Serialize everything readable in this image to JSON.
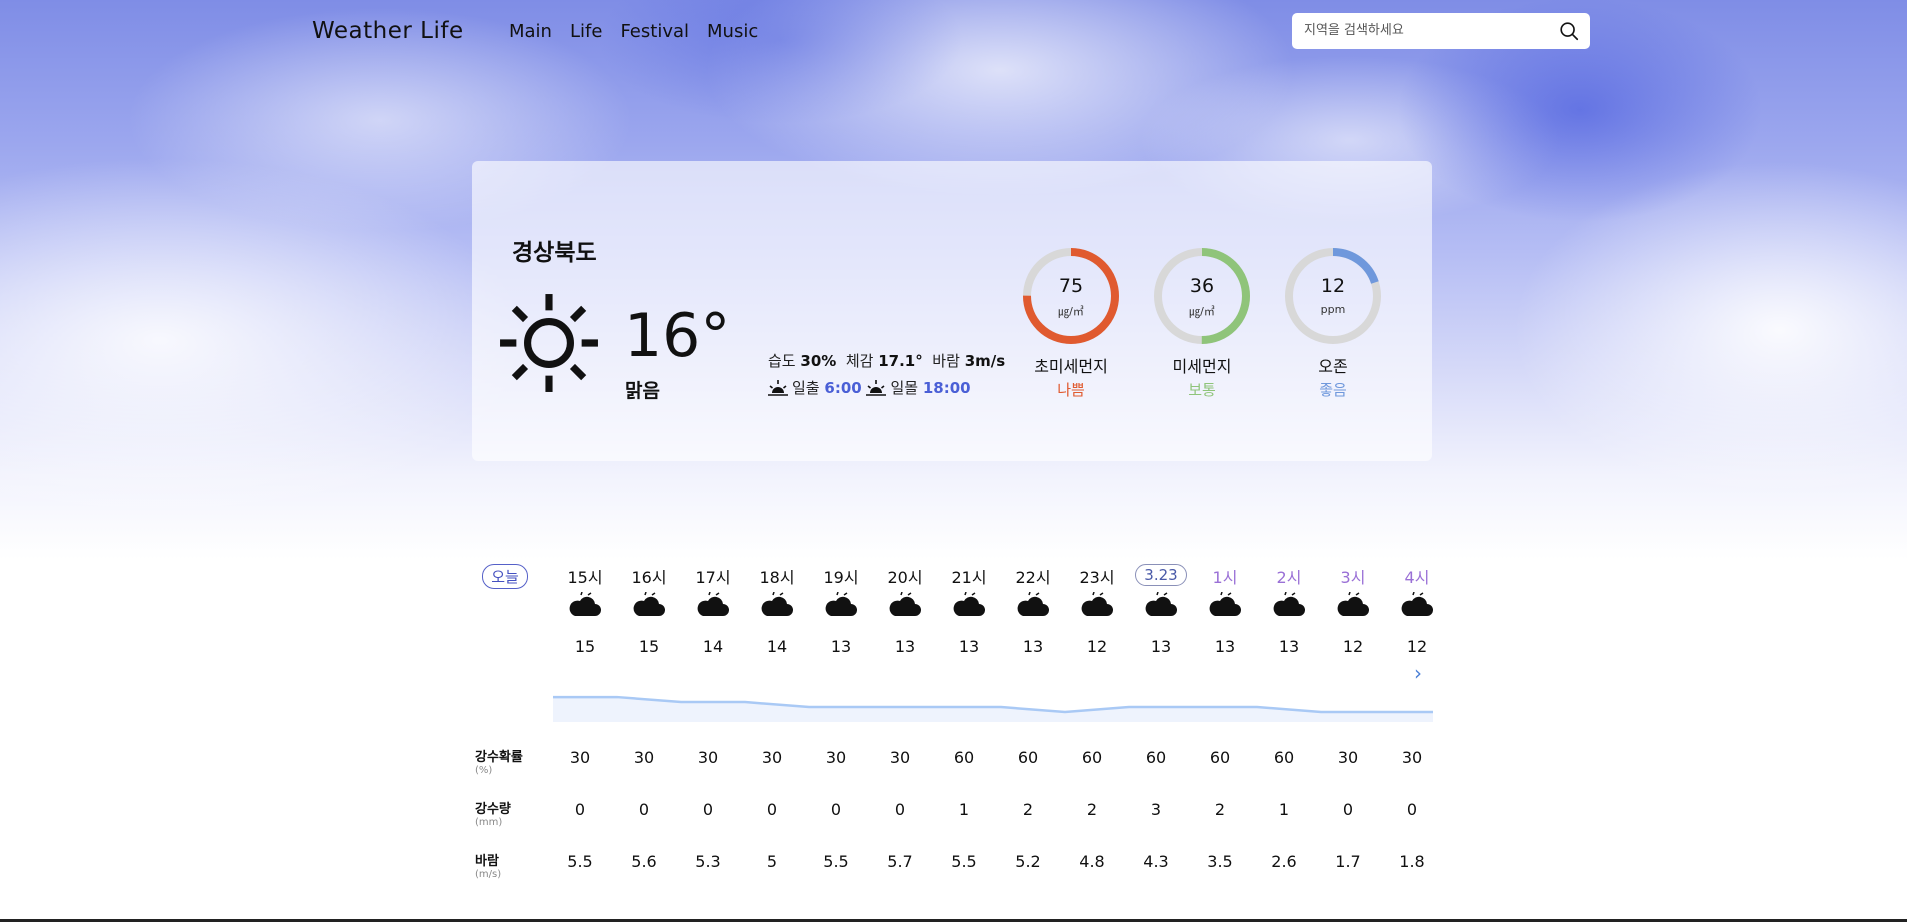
{
  "header": {
    "logo": "Weather Life",
    "nav": [
      "Main",
      "Life",
      "Festival",
      "Music"
    ],
    "search_placeholder": "지역을 검색하세요",
    "search_icon": "search-icon"
  },
  "current": {
    "region": "경상북도",
    "temperature": "16°",
    "condition": "맑음",
    "weather_icon": "sun-icon",
    "humidity_label": "습도",
    "humidity": "30%",
    "feels_label": "체감",
    "feels": "17.1°",
    "wind_label": "바람",
    "wind": "3m/s",
    "sunrise_label": "일출",
    "sunrise": "6:00",
    "sunset_label": "일몰",
    "sunset": "18:00"
  },
  "air": [
    {
      "value": "75",
      "unit": "㎍/㎥",
      "name": "초미세먼지",
      "status": "나쁨",
      "color": "#e05a2f",
      "fraction": 0.75
    },
    {
      "value": "36",
      "unit": "㎍/㎥",
      "name": "미세먼지",
      "status": "보통",
      "color": "#8fc47a",
      "fraction": 0.5
    },
    {
      "value": "12",
      "unit": "ppm",
      "name": "오존",
      "status": "좋음",
      "color": "#6f98dc",
      "fraction": 0.2
    }
  ],
  "forecast": {
    "today_label": "오늘",
    "hours": [
      "15시",
      "16시",
      "17시",
      "18시",
      "19시",
      "20시",
      "21시",
      "22시",
      "23시",
      "3.23",
      "1시",
      "2시",
      "3시",
      "4시"
    ],
    "icon": "cloud-icon",
    "temps": [
      15,
      15,
      14,
      14,
      13,
      13,
      13,
      13,
      12,
      13,
      13,
      13,
      12,
      12
    ],
    "metrics": [
      {
        "label": "강수확률",
        "unit": "(%)",
        "values": [
          "30",
          "30",
          "30",
          "30",
          "30",
          "30",
          "60",
          "60",
          "60",
          "60",
          "60",
          "60",
          "30",
          "30"
        ]
      },
      {
        "label": "강수량",
        "unit": "(mm)",
        "values": [
          "0",
          "0",
          "0",
          "0",
          "0",
          "0",
          "1",
          "2",
          "2",
          "3",
          "2",
          "1",
          "0",
          "0"
        ]
      },
      {
        "label": "바람",
        "unit": "(m/s)",
        "values": [
          "5.5",
          "5.6",
          "5.3",
          "5",
          "5.5",
          "5.7",
          "5.5",
          "5.2",
          "4.8",
          "4.3",
          "3.5",
          "2.6",
          "1.7",
          "1.8"
        ]
      }
    ]
  }
}
